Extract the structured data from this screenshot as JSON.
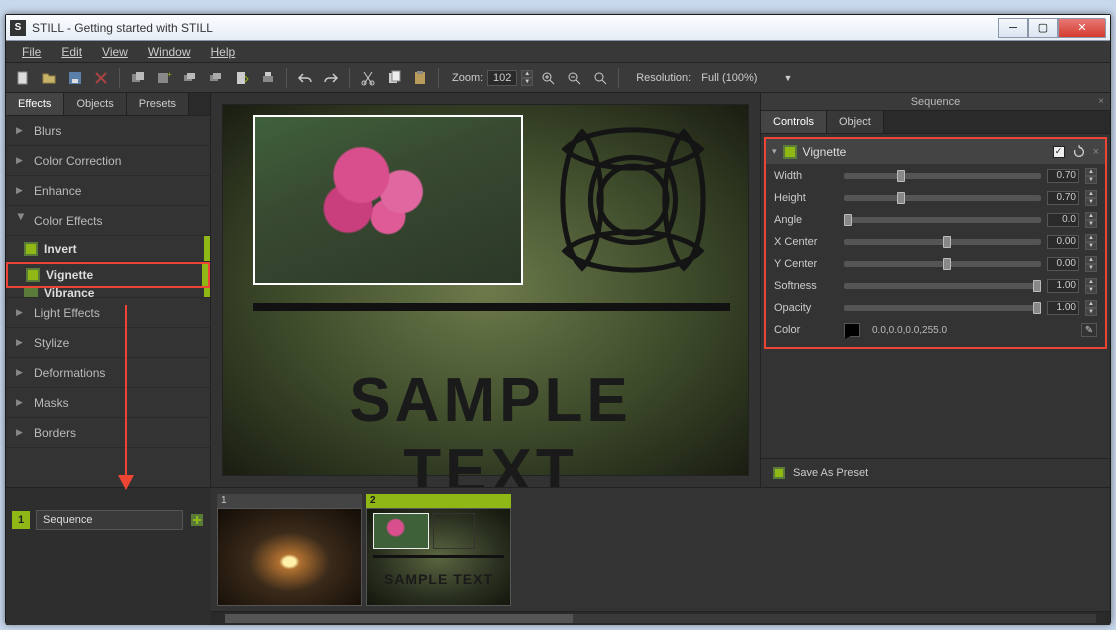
{
  "window_title": "STILL - Getting started with STILL",
  "menu": [
    "File",
    "Edit",
    "View",
    "Window",
    "Help"
  ],
  "toolbar": {
    "zoom_label": "Zoom:",
    "zoom_value": "102",
    "resolution_label": "Resolution:",
    "resolution_value": "Full (100%)"
  },
  "left_tabs": {
    "effects": "Effects",
    "objects": "Objects",
    "presets": "Presets"
  },
  "categories": {
    "blurs": "Blurs",
    "color_correction": "Color Correction",
    "enhance": "Enhance",
    "color_effects": "Color Effects",
    "light_effects": "Light Effects",
    "stylize": "Stylize",
    "deformations": "Deformations",
    "masks": "Masks",
    "borders": "Borders"
  },
  "color_effects_children": {
    "invert": "Invert",
    "vignette": "Vignette",
    "vibrance": "Vibrance"
  },
  "canvas_text": "SAMPLE TEXT",
  "sequence_panel": {
    "title": "Sequence",
    "tab_controls": "Controls",
    "tab_object": "Object",
    "effect_name": "Vignette",
    "params": {
      "width": {
        "label": "Width",
        "value": "0.70",
        "pos": 27
      },
      "height": {
        "label": "Height",
        "value": "0.70",
        "pos": 27
      },
      "angle": {
        "label": "Angle",
        "value": "0.0",
        "pos": 0
      },
      "xcenter": {
        "label": "X Center",
        "value": "0.00",
        "pos": 50
      },
      "ycenter": {
        "label": "Y Center",
        "value": "0.00",
        "pos": 50
      },
      "softness": {
        "label": "Softness",
        "value": "1.00",
        "pos": 100
      },
      "opacity": {
        "label": "Opacity",
        "value": "1.00",
        "pos": 100
      }
    },
    "color_label": "Color",
    "color_value": "0.0,0.0,0.0,255.0",
    "save_preset": "Save As Preset"
  },
  "timeline": {
    "sequence_name": "Sequence",
    "sequence_num": "1",
    "thumbs": {
      "t1": "1",
      "t2": "2"
    }
  }
}
